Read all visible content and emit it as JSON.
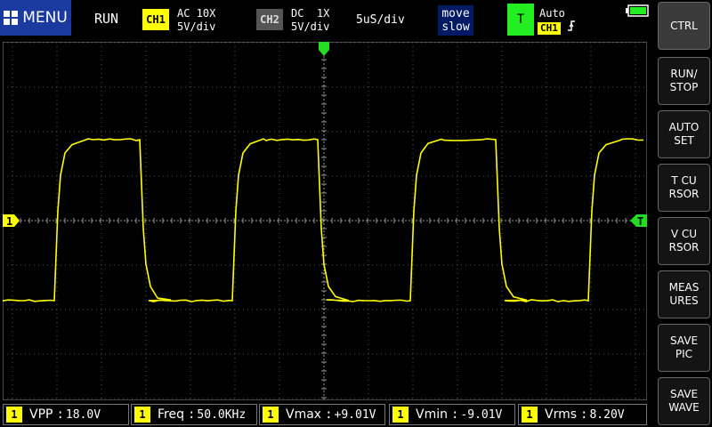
{
  "top": {
    "menu_label": "MENU",
    "run_state": "RUN",
    "ch1": {
      "badge": "CH1",
      "coupling": "AC 10X",
      "scale": "5V/div"
    },
    "ch2": {
      "badge": "CH2",
      "coupling": "DC  1X",
      "scale": "5V/div"
    },
    "timebase": "5uS/div",
    "move": {
      "line1": "move",
      "line2": "slow"
    },
    "trigger": {
      "badge": "T",
      "mode": "Auto",
      "source": "CH1"
    },
    "battery_color": "#22ee22"
  },
  "side_buttons": [
    {
      "label": "CTRL"
    },
    {
      "label": "RUN/\nSTOP"
    },
    {
      "label": "AUTO\nSET"
    },
    {
      "label": "T CU\nRSOR"
    },
    {
      "label": "V CU\nRSOR"
    },
    {
      "label": "MEAS\nURES"
    },
    {
      "label": "SAVE\nPIC"
    },
    {
      "label": "SAVE\nWAVE"
    }
  ],
  "screen": {
    "ch1_marker": "1",
    "trigger_marker": "T",
    "trace_color": "#ffff00",
    "marker_color": "#22dd22"
  },
  "measurements": [
    {
      "ch": "1",
      "label": "VPP",
      "value": "18.0V"
    },
    {
      "ch": "1",
      "label": "Freq",
      "value": "50.0KHz"
    },
    {
      "ch": "1",
      "label": "Vmax",
      "value": "+9.01V"
    },
    {
      "ch": "1",
      "label": "Vmin",
      "value": "-9.01V"
    },
    {
      "ch": "1",
      "label": "Vrms",
      "value": "8.20V"
    }
  ]
}
